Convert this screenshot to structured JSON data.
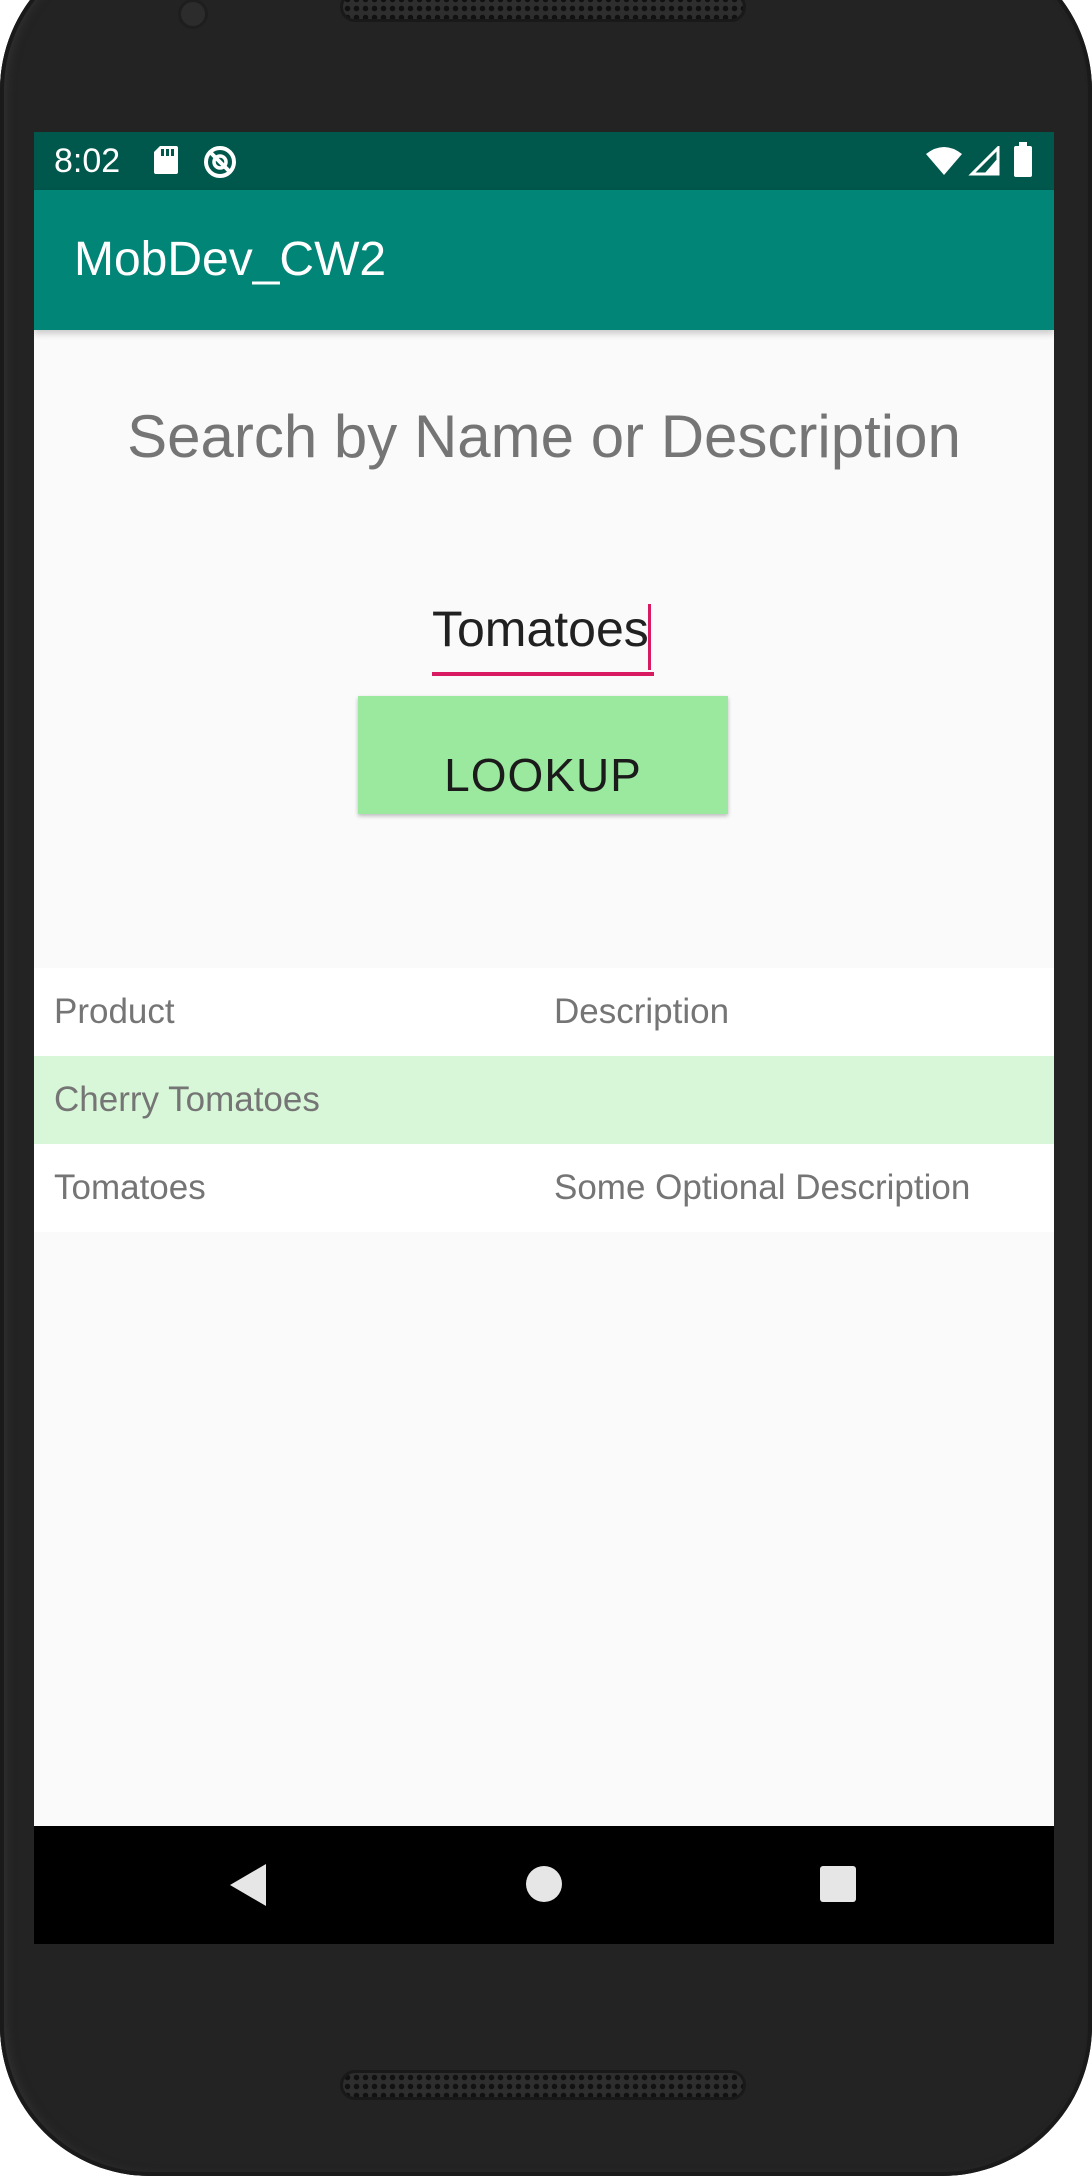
{
  "status_bar": {
    "time": "8:02",
    "left_icons": [
      "sd-card-icon",
      "do-not-disturb-icon"
    ],
    "right_icons": [
      "wifi-icon",
      "signal-icon",
      "battery-icon"
    ]
  },
  "app_bar": {
    "title": "MobDev_CW2"
  },
  "search": {
    "heading": "Search by Name or Description",
    "input_value": "Tomatoes",
    "button_label": "LOOKUP"
  },
  "results": {
    "headers": {
      "product": "Product",
      "description": "Description"
    },
    "rows": [
      {
        "product": "Cherry Tomatoes",
        "description": ""
      },
      {
        "product": "Tomatoes",
        "description": "Some Optional Description"
      }
    ]
  },
  "nav_bar": {
    "buttons": [
      "back-icon",
      "home-icon",
      "recents-icon"
    ]
  },
  "colors": {
    "status_bar": "#00574b",
    "app_bar": "#008577",
    "accent": "#d81b60",
    "button": "#9ae99e",
    "highlight_row": "#d8f7d8"
  }
}
